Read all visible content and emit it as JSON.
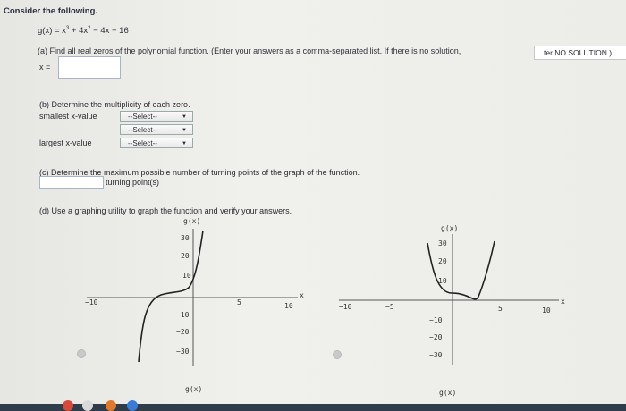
{
  "header": {
    "title": "Consider the following."
  },
  "function": {
    "text": "g(x) = x",
    "exp1": "3",
    "mid": " + 4x",
    "exp2": "2",
    "tail": " − 4x − 16"
  },
  "part_a": {
    "prompt": "(a) Find all real zeros of the polynomial function. (Enter your answers as a comma-separated list. If there is no solution,",
    "no_solution_text": "ter NO SOLUTION.)",
    "x_label": "x =",
    "x_value": ""
  },
  "part_b": {
    "prompt": "(b) Determine the multiplicity of each zero.",
    "smallest_label": "smallest x-value",
    "largest_label": "largest x-value",
    "selects": [
      "--Select--",
      "--Select--",
      "--Select--"
    ]
  },
  "part_c": {
    "prompt": "(c) Determine the maximum possible number of turning points of the graph of the function.",
    "suffix": "turning point(s)",
    "value": ""
  },
  "part_d": {
    "prompt": "(d) Use a graphing utility to graph the function and verify your answers."
  },
  "graphs": {
    "left": {
      "ylabel_top": "g(x)",
      "ylabel_bottom": "g(x)",
      "xlabel": "x",
      "xticks": [
        "−10",
        "5",
        "10"
      ],
      "yticks": [
        "30",
        "20",
        "10",
        "−10",
        "−20",
        "−30"
      ]
    },
    "right": {
      "ylabel_top": "g(x)",
      "ylabel_bottom": "g(x)",
      "xlabel": "x",
      "xticks": [
        "−10",
        "−5",
        "5",
        "10"
      ],
      "yticks": [
        "30",
        "20",
        "10",
        "−10",
        "−20",
        "−30"
      ]
    }
  },
  "colors": {
    "page": "#ececE8",
    "taskbar": "#2f3c4a",
    "input_border": "#a8b4c8"
  }
}
